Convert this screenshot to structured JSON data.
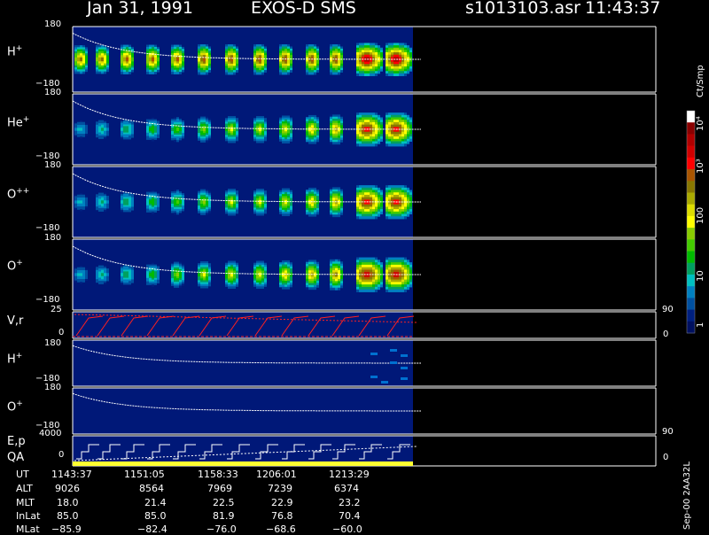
{
  "header": {
    "date": "Jan 31, 1991",
    "instrument": "EXOS-D SMS",
    "file": "s1013103.asr",
    "time": "11:43:37"
  },
  "panels": [
    {
      "id": "hplus",
      "label": "H",
      "sup": "+",
      "ytop": "180",
      "ybot": "−180"
    },
    {
      "id": "heplus",
      "label": "He",
      "sup": "+",
      "ytop": "180",
      "ybot": "−180"
    },
    {
      "id": "oplusplus",
      "label": "O",
      "sup": "++",
      "ytop": "180",
      "ybot": "−180"
    },
    {
      "id": "oplus",
      "label": "O",
      "sup": "+",
      "ytop": "180",
      "ybot": "−180"
    },
    {
      "id": "vr",
      "label": "V,r",
      "sup": "",
      "ytop": "25",
      "ybot": "0",
      "rtop": "90",
      "rbot": "0"
    },
    {
      "id": "hplus2",
      "label": "H",
      "sup": "+",
      "ytop": "180",
      "ybot": "−180"
    },
    {
      "id": "oplus2",
      "label": "O",
      "sup": "+",
      "ytop": "180",
      "ybot": "−180"
    },
    {
      "id": "ep",
      "label": "E,p",
      "label2": "QA",
      "sup": "",
      "ytop": "4000",
      "ybot": "0",
      "rtop": "90",
      "rbot": "0"
    }
  ],
  "colorbar": {
    "unit": "Ct/Smp",
    "ticks": [
      "10⁴",
      "10³",
      "100",
      "10",
      "1"
    ],
    "colors": [
      "#ffffff",
      "#8b0000",
      "#b00000",
      "#d00000",
      "#ff0000",
      "#aa5500",
      "#887700",
      "#aaaa00",
      "#dddd00",
      "#ffff00",
      "#88cc00",
      "#44cc00",
      "#00bb00",
      "#00a060",
      "#00c0c0",
      "#0080c0",
      "#0050a0",
      "#002080",
      "#001060"
    ]
  },
  "footer_code": "Sep-00 2AA32L",
  "ephemeris": {
    "row_labels": [
      "UT",
      "ALT",
      "MLT",
      "InLat",
      "MLat"
    ],
    "columns": [
      [
        "1143:37",
        "9026",
        "18.0",
        "85.0",
        "−85.9"
      ],
      [
        "1151:05",
        "8564",
        "21.4",
        "85.0",
        "−82.4"
      ],
      [
        "1158:33",
        "7969",
        "22.5",
        "81.9",
        "−76.0"
      ],
      [
        "1206:01",
        "7239",
        "22.9",
        "76.8",
        "−68.6"
      ],
      [
        "1213:29",
        "6374",
        "23.2",
        "70.4",
        "−60.0"
      ]
    ]
  },
  "chart_data": {
    "type": "heatmap",
    "time_range": [
      "11:43:37",
      "12:18:00"
    ],
    "pitch_angle_range": [
      -180,
      180
    ],
    "color_scale": "log",
    "color_range": [
      1,
      10000
    ],
    "pulse_count": 13,
    "pulse_relative_intensity": {
      "H+": [
        0.75,
        0.75,
        0.8,
        0.8,
        0.8,
        0.85,
        0.85,
        0.85,
        0.85,
        0.85,
        0.85,
        1.0,
        1.0
      ],
      "He+": [
        0.25,
        0.3,
        0.35,
        0.4,
        0.45,
        0.5,
        0.55,
        0.55,
        0.6,
        0.65,
        0.7,
        0.9,
        0.9
      ],
      "O++": [
        0.25,
        0.3,
        0.35,
        0.4,
        0.45,
        0.5,
        0.55,
        0.55,
        0.6,
        0.65,
        0.7,
        0.9,
        0.9
      ],
      "O+": [
        0.25,
        0.3,
        0.35,
        0.4,
        0.5,
        0.55,
        0.6,
        0.6,
        0.65,
        0.7,
        0.75,
        0.95,
        0.95
      ]
    }
  }
}
